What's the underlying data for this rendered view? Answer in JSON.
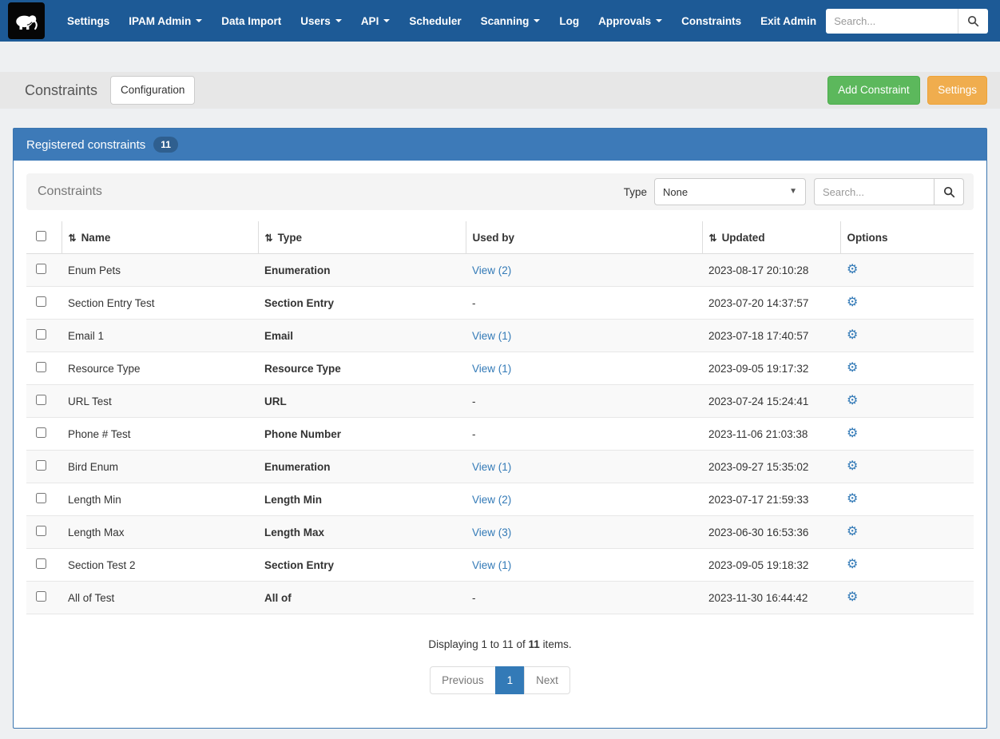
{
  "colors": {
    "navbar_bg": "#1d5a96",
    "panel_heading_bg": "#3d7ab8",
    "link": "#337ab7",
    "success_button": "#5cb85c",
    "warning_button": "#f0ad4e"
  },
  "navbar": {
    "search": {
      "placeholder": "Search..."
    },
    "items": [
      {
        "label": "Settings",
        "dropdown": false
      },
      {
        "label": "IPAM Admin",
        "dropdown": true
      },
      {
        "label": "Data Import",
        "dropdown": false
      },
      {
        "label": "Users",
        "dropdown": true
      },
      {
        "label": "API",
        "dropdown": true
      },
      {
        "label": "Scheduler",
        "dropdown": false
      },
      {
        "label": "Scanning",
        "dropdown": true
      },
      {
        "label": "Log",
        "dropdown": false
      },
      {
        "label": "Approvals",
        "dropdown": true
      },
      {
        "label": "Constraints",
        "dropdown": false
      },
      {
        "label": "Exit Admin",
        "dropdown": false
      }
    ]
  },
  "page_header": {
    "title": "Constraints",
    "configuration_button": "Configuration",
    "add_constraint_button": "Add Constraint",
    "settings_button": "Settings"
  },
  "panel": {
    "title": "Registered constraints",
    "count_badge": "11",
    "toolbar": {
      "title": "Constraints",
      "type_label": "Type",
      "type_value": "None",
      "search_placeholder": "Search..."
    },
    "table": {
      "headers": [
        "Name",
        "Type",
        "Used by",
        "Updated",
        "Options"
      ],
      "rows": [
        {
          "name": "Enum Pets",
          "type": "Enumeration",
          "used_by": "View (2)",
          "updated": "2023-08-17 20:10:28"
        },
        {
          "name": "Section Entry Test",
          "type": "Section Entry",
          "used_by": "-",
          "updated": "2023-07-20 14:37:57"
        },
        {
          "name": "Email 1",
          "type": "Email",
          "used_by": "View (1)",
          "updated": "2023-07-18 17:40:57"
        },
        {
          "name": "Resource Type",
          "type": "Resource Type",
          "used_by": "View (1)",
          "updated": "2023-09-05 19:17:32"
        },
        {
          "name": "URL Test",
          "type": "URL",
          "used_by": "-",
          "updated": "2023-07-24 15:24:41"
        },
        {
          "name": "Phone # Test",
          "type": "Phone Number",
          "used_by": "-",
          "updated": "2023-11-06 21:03:38"
        },
        {
          "name": "Bird Enum",
          "type": "Enumeration",
          "used_by": "View (1)",
          "updated": "2023-09-27 15:35:02"
        },
        {
          "name": "Length Min",
          "type": "Length Min",
          "used_by": "View (2)",
          "updated": "2023-07-17 21:59:33"
        },
        {
          "name": "Length Max",
          "type": "Length Max",
          "used_by": "View (3)",
          "updated": "2023-06-30 16:53:36"
        },
        {
          "name": "Section Test 2",
          "type": "Section Entry",
          "used_by": "View (1)",
          "updated": "2023-09-05 19:18:32"
        },
        {
          "name": "All of Test",
          "type": "All of",
          "used_by": "-",
          "updated": "2023-11-30 16:44:42"
        }
      ]
    },
    "footer": {
      "displaying_prefix": "Displaying 1 to 11 of",
      "total": "11",
      "suffix": "items.",
      "pagination": {
        "previous": "Previous",
        "page": "1",
        "next": "Next"
      }
    }
  }
}
